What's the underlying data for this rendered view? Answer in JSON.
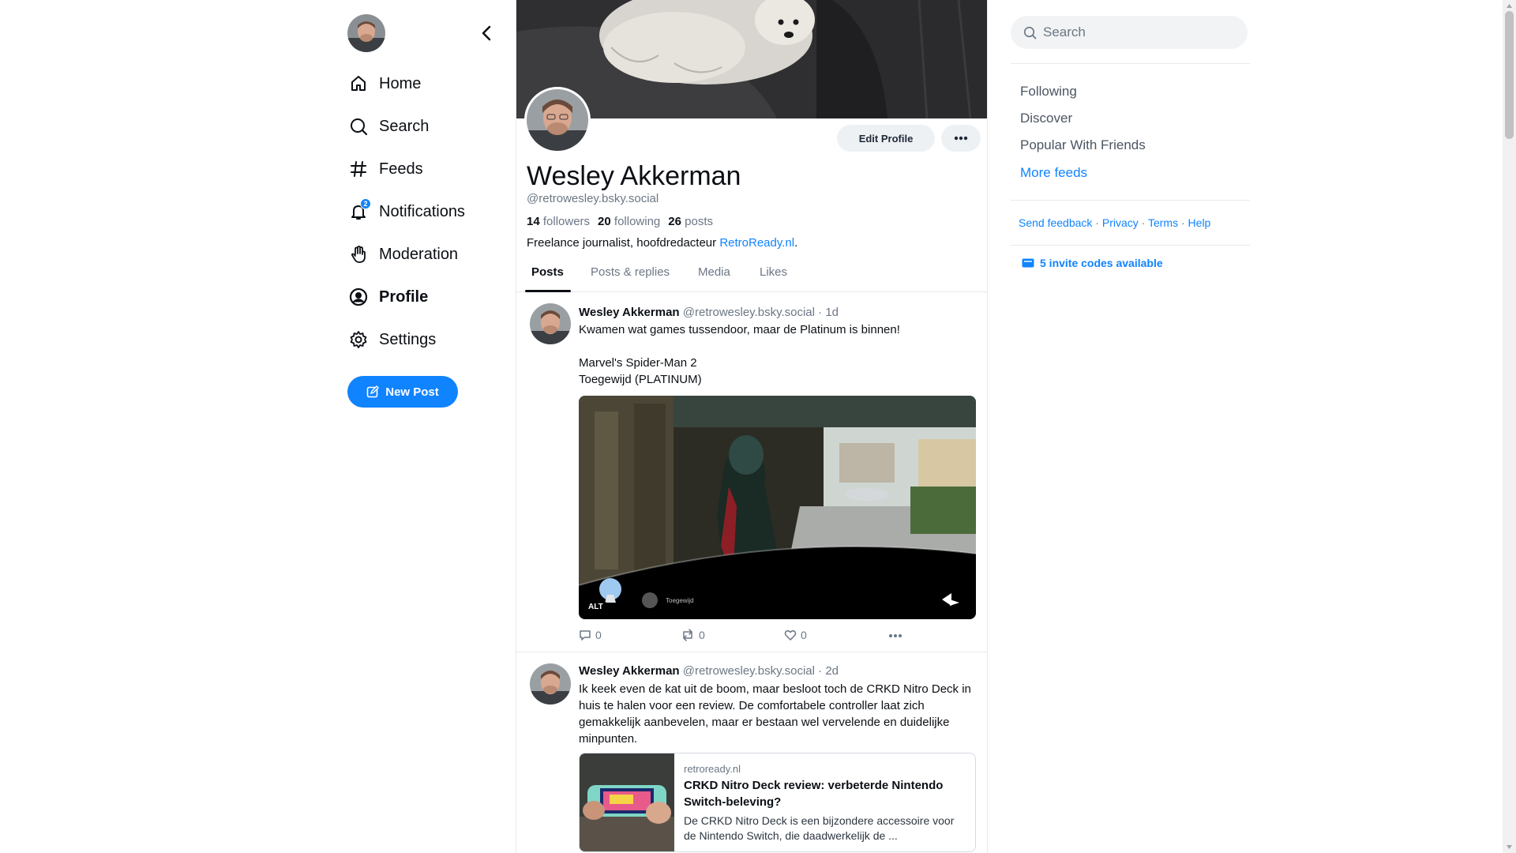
{
  "nav": {
    "items": [
      {
        "label": "Home",
        "icon": "home-icon"
      },
      {
        "label": "Search",
        "icon": "search-icon"
      },
      {
        "label": "Feeds",
        "icon": "hash-icon"
      },
      {
        "label": "Notifications",
        "icon": "bell-icon",
        "badge": "2"
      },
      {
        "label": "Moderation",
        "icon": "hand-icon"
      },
      {
        "label": "Profile",
        "icon": "user-circle-icon"
      },
      {
        "label": "Settings",
        "icon": "gear-icon"
      }
    ],
    "new_post": "New Post"
  },
  "profile": {
    "name": "Wesley Akkerman",
    "handle": "@retrowesley.bsky.social",
    "followers_count": "14",
    "followers_label": "followers",
    "following_count": "20",
    "following_label": "following",
    "posts_count": "26",
    "posts_label": "posts",
    "bio_text": "Freelance journalist, hoofdredacteur ",
    "bio_link": "RetroReady.nl",
    "bio_end": ".",
    "edit_button": "Edit Profile",
    "tabs": [
      "Posts",
      "Posts & replies",
      "Media",
      "Likes"
    ]
  },
  "posts": [
    {
      "author": "Wesley Akkerman",
      "handle": "@retrowesley.bsky.social",
      "time": "· 1d",
      "text_lines": [
        "Kwamen wat games tussendoor, maar de Platinum is binnen!",
        "",
        "Marvel's Spider-Man 2",
        "Toegewijd (PLATINUM)"
      ],
      "image_alt_badge": "ALT",
      "image_caption": "Toegewijd",
      "replies": "0",
      "reposts": "0",
      "likes": "0"
    },
    {
      "author": "Wesley Akkerman",
      "handle": "@retrowesley.bsky.social",
      "time": "· 2d",
      "text": "Ik keek even de kat uit de boom, maar besloot toch de CRKD Nitro Deck in huis te halen voor een review. De comfortabele controller laat zich gemakkelijk aanbevelen, maar er bestaan wel vervelende en duidelijke minpunten.",
      "card": {
        "domain": "retroready.nl",
        "title": "CRKD Nitro Deck review: verbeterde Nintendo Switch-beleving?",
        "description": "De CRKD Nitro Deck is een bijzondere accessoire voor de Nintendo Switch, die daadwerkelijk de ..."
      }
    }
  ],
  "right": {
    "search_placeholder": "Search",
    "feeds": [
      "Following",
      "Discover",
      "Popular With Friends"
    ],
    "more_feeds": "More feeds",
    "footer": [
      "Send feedback",
      "Privacy",
      "Terms",
      "Help"
    ],
    "footer_sep": "·",
    "invite": "5 invite codes available"
  },
  "colors": {
    "accent": "#1083fe",
    "text": "#0b0f14",
    "muted": "#6b7785"
  }
}
